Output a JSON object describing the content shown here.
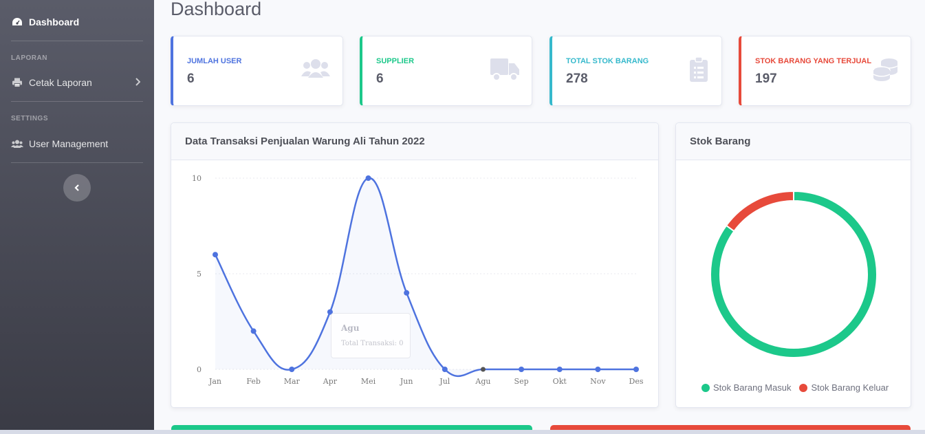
{
  "sidebar": {
    "dashboard_label": "Dashboard",
    "heading_laporan": "LAPORAN",
    "cetak_label": "Cetak Laporan",
    "heading_settings": "SETTINGS",
    "user_mgmt_label": "User Management"
  },
  "page": {
    "title": "Dashboard"
  },
  "stats": [
    {
      "label": "JUMLAH USER",
      "value": "6",
      "color": "#4e73df",
      "icon": "users-icon"
    },
    {
      "label": "SUPPLIER",
      "value": "6",
      "color": "#1cc88a",
      "icon": "truck-icon"
    },
    {
      "label": "TOTAL STOK BARANG",
      "value": "278",
      "color": "#36b9cc",
      "icon": "clipboard-list-icon"
    },
    {
      "label": "STOK BARANG YANG TERJUAL",
      "value": "197",
      "color": "#e74a3b",
      "icon": "coins-icon"
    }
  ],
  "line_card": {
    "title": "Data Transaksi Penjualan Warung Ali Tahun 2022"
  },
  "donut_card": {
    "title": "Stok Barang"
  },
  "tooltip": {
    "title": "Agu",
    "body": "Total Transaksi: 0"
  },
  "chart_data": [
    {
      "type": "line",
      "title": "Data Transaksi Penjualan Warung Ali Tahun 2022",
      "categories": [
        "Jan",
        "Feb",
        "Mar",
        "Apr",
        "Mei",
        "Jun",
        "Jul",
        "Agu",
        "Sep",
        "Okt",
        "Nov",
        "Des"
      ],
      "series": [
        {
          "name": "Total Transaksi",
          "values": [
            6,
            2,
            0,
            3,
            10,
            4,
            0,
            0,
            0,
            0,
            0,
            0
          ]
        }
      ],
      "yticks": [
        "0",
        "5",
        "10"
      ],
      "ylim": [
        0,
        10
      ],
      "color": "#4e73df",
      "grid": true
    },
    {
      "type": "pie",
      "title": "Stok Barang",
      "labels": [
        "Stok Barang Masuk",
        "Stok Barang Keluar"
      ],
      "values": [
        85,
        15
      ],
      "colors": [
        "#1cc88a",
        "#e74a3b"
      ],
      "legend": "bottom"
    }
  ]
}
